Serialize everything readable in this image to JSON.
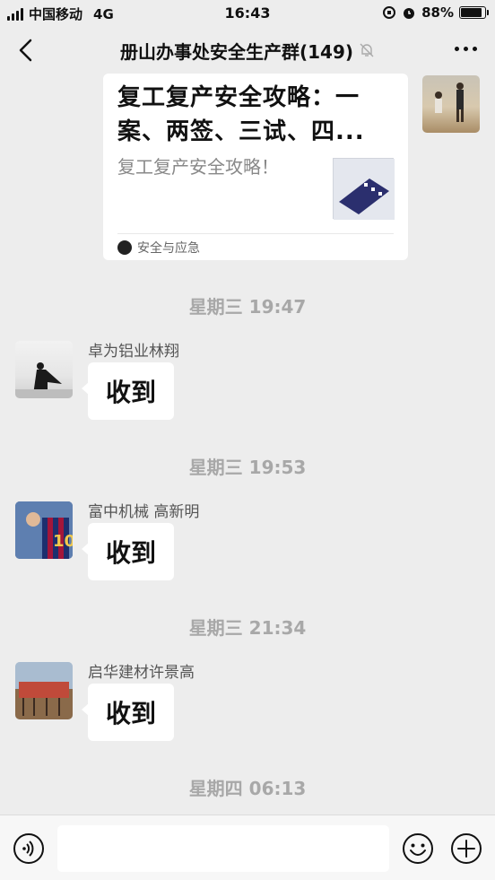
{
  "status_bar": {
    "carrier": "中国移动",
    "network": "4G",
    "time": "16:43",
    "battery_text": "88%",
    "battery_level": 0.88
  },
  "nav": {
    "title": "册山办事处安全生产群(149)"
  },
  "article": {
    "title": "复工复产安全攻略：一案、两签、三试、四...",
    "description": "复工复产安全攻略！",
    "source": "安全与应急"
  },
  "messages": [
    {
      "timestamp": "星期三 19:47",
      "sender": "卓为铝业林翔",
      "text": "收到"
    },
    {
      "timestamp": "星期三 19:53",
      "sender": "富中机械 高新明",
      "text": "收到"
    },
    {
      "timestamp": "星期三 21:34",
      "sender": "启华建材许景高",
      "text": "收到"
    }
  ],
  "trailing_timestamp": "星期四 06:13",
  "input": {
    "value": "",
    "placeholder": ""
  },
  "colors": {
    "background": "#ededed",
    "bubble": "#ffffff",
    "timestamp": "#a8a8a8"
  },
  "icons": [
    "back-icon",
    "mute-icon",
    "more-icon",
    "voice-icon",
    "emoji-icon",
    "plus-icon",
    "signal-icon",
    "battery-icon",
    "alarm-icon",
    "orientation-lock-icon"
  ]
}
